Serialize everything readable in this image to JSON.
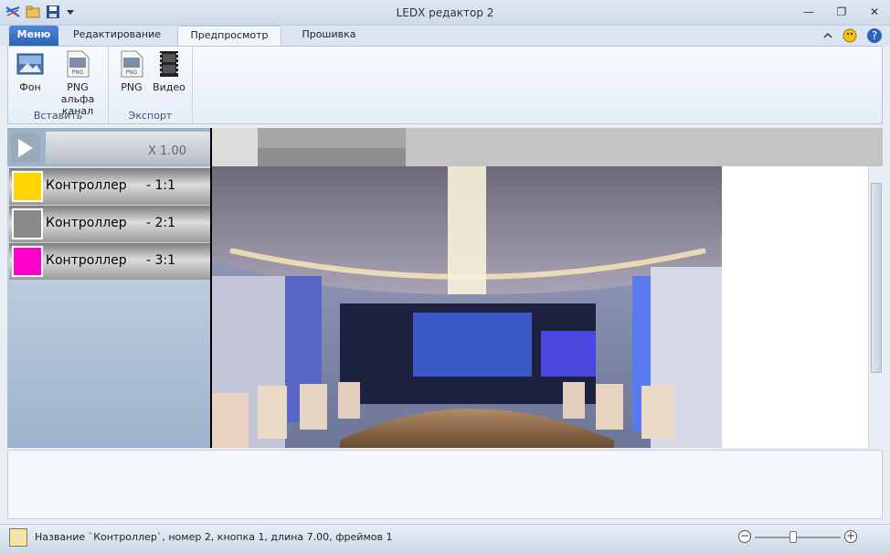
{
  "window": {
    "title": "LEDX редактор 2"
  },
  "tabs": [
    {
      "label": "Меню"
    },
    {
      "label": "Редактирование"
    },
    {
      "label": "Предпросмотр"
    },
    {
      "label": "Прошивка"
    }
  ],
  "ribbon": {
    "insert_group": {
      "label": "Вставить",
      "buttons": [
        {
          "label": "Фон",
          "icon": "background-image-icon"
        },
        {
          "label": "PNG альфа канал",
          "icon": "png-alpha-icon"
        }
      ]
    },
    "export_group": {
      "label": "Экспорт",
      "buttons": [
        {
          "label": "PNG",
          "icon": "png-file-icon"
        },
        {
          "label": "Видео",
          "icon": "video-film-icon"
        }
      ]
    }
  },
  "player": {
    "speed": "X 1.00"
  },
  "controllers": [
    {
      "name": "Контроллер",
      "index": "- 1:1",
      "color": "#ffd400"
    },
    {
      "name": "Контроллер",
      "index": "- 2:1",
      "color": "#8a8a8a"
    },
    {
      "name": "Контроллер",
      "index": "- 3:1",
      "color": "#ff00c8"
    }
  ],
  "status": {
    "text": "Название `Контроллер`, номер 2, кнопка 1, длина 7.00, фреймов 1",
    "zoom_fraction": 0.45
  },
  "colors": {
    "menu_tab": "#2d62b6",
    "accent": "#dbe5f1"
  }
}
